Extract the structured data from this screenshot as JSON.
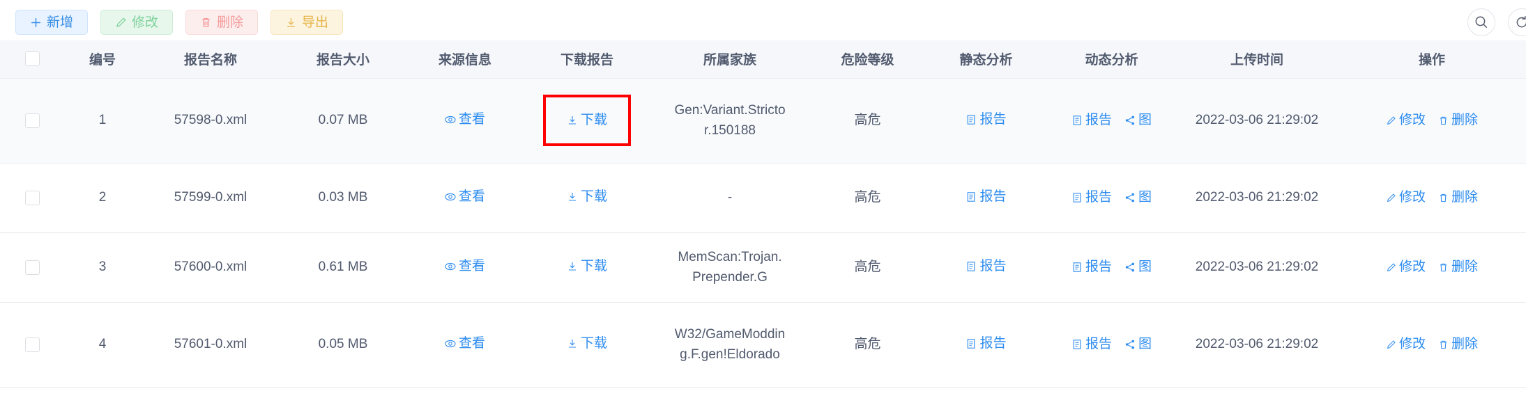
{
  "toolbar": {
    "buttons": [
      {
        "label": "新增",
        "icon": "plus-icon",
        "style": "add"
      },
      {
        "label": "修改",
        "icon": "pencil-icon",
        "style": "edit"
      },
      {
        "label": "删除",
        "icon": "trash-icon",
        "style": "del"
      },
      {
        "label": "导出",
        "icon": "download-icon",
        "style": "export"
      }
    ],
    "right_icons": [
      {
        "name": "search-icon"
      },
      {
        "name": "refresh-icon"
      }
    ]
  },
  "table": {
    "columns": [
      "",
      "编号",
      "报告名称",
      "报告大小",
      "来源信息",
      "下载报告",
      "所属家族",
      "危险等级",
      "静态分析",
      "动态分析",
      "上传时间",
      "操作"
    ],
    "labels": {
      "view": "查看",
      "download": "下载",
      "report": "报告",
      "graph": "图",
      "edit": "修改",
      "delete": "删除"
    },
    "rows": [
      {
        "id": "1",
        "name": "57598-0.xml",
        "size": "0.07 MB",
        "family": "Gen:Variant.Strictor.150188",
        "risk": "高危",
        "time": "2022-03-06 21:29:02",
        "highlight_download": true,
        "hover": true
      },
      {
        "id": "2",
        "name": "57599-0.xml",
        "size": "0.03 MB",
        "family": "-",
        "risk": "高危",
        "time": "2022-03-06 21:29:02",
        "highlight_download": false,
        "hover": false
      },
      {
        "id": "3",
        "name": "57600-0.xml",
        "size": "0.61 MB",
        "family": "MemScan:Trojan.Prepender.G",
        "risk": "高危",
        "time": "2022-03-06 21:29:02",
        "highlight_download": false,
        "hover": false
      },
      {
        "id": "4",
        "name": "57601-0.xml",
        "size": "0.05 MB",
        "family": "W32/GameModding.F.gen!Eldorado",
        "risk": "高危",
        "time": "2022-03-06 21:29:02",
        "highlight_download": false,
        "hover": false
      }
    ]
  },
  "colors": {
    "link": "#2d8cf0",
    "header_bg": "#f5f7fa",
    "highlight": "#ff0000",
    "text": "#515a6e"
  }
}
